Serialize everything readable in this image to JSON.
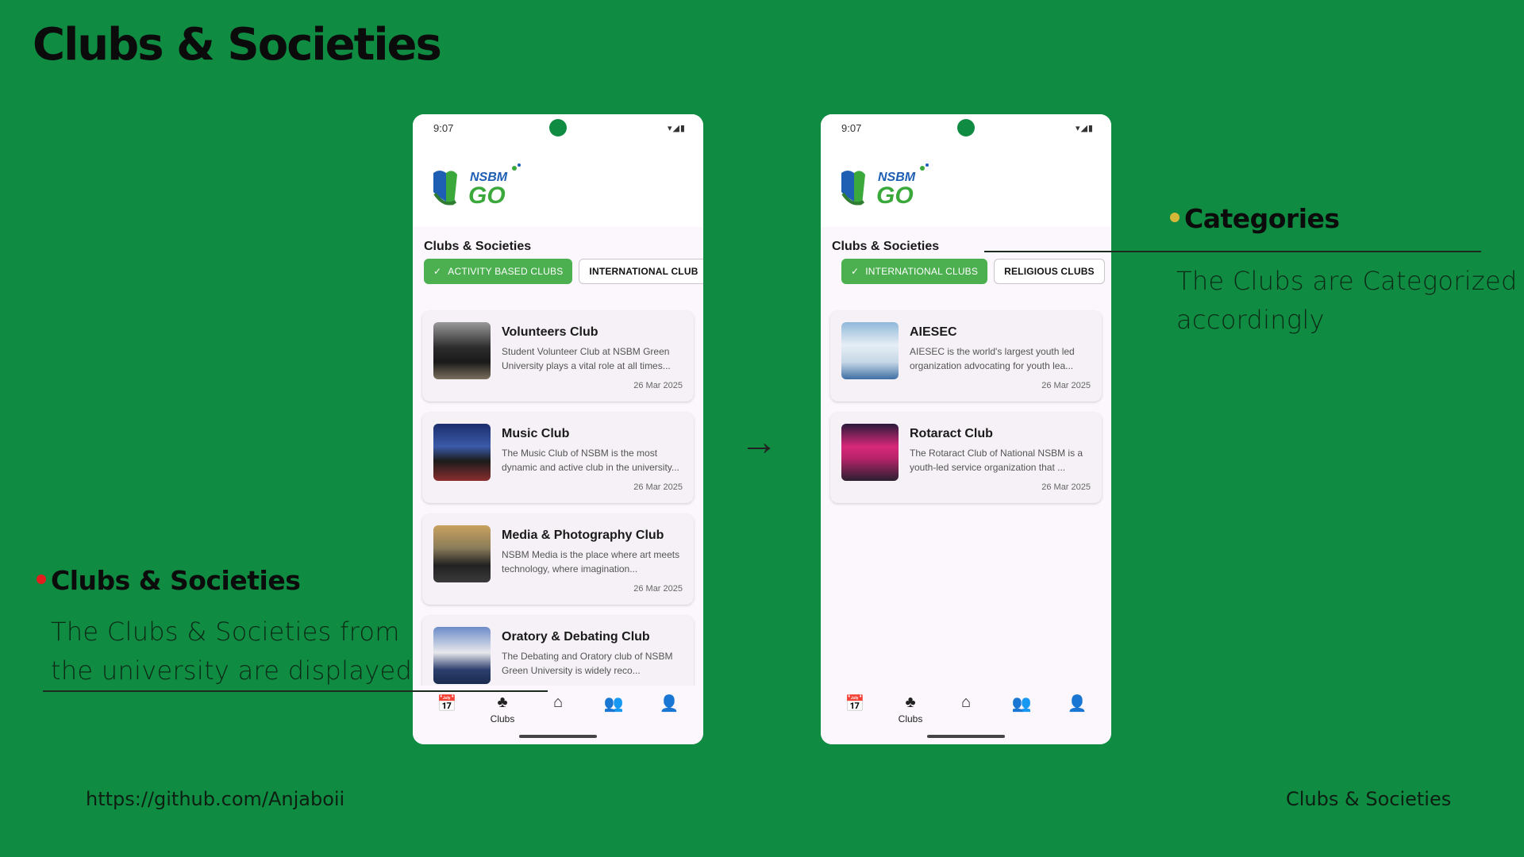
{
  "slide": {
    "title": "Clubs & Societies",
    "footer_left": "https://github.com/Anjaboii",
    "footer_right": "Clubs & Societies"
  },
  "annotations": {
    "categories": {
      "title": "Categories",
      "text_line1": "The Clubs are Categorized",
      "text_line2": "accordingly",
      "dot_color": "#d6b838"
    },
    "clubs": {
      "title": "Clubs & Societies",
      "text_line1": "The Clubs & Societies from",
      "text_line2": "the university are displayed",
      "dot_color": "#e11d1d"
    }
  },
  "arrow": "→",
  "colors": {
    "background": "#0f8c42",
    "chip_active": "#4caf50"
  },
  "phones": [
    {
      "status_time": "9:07",
      "status_icons": "▾◢▮",
      "logo_text": "NSBM GO",
      "section_title": "Clubs & Societies",
      "chips": [
        {
          "label": "ACTIVITY BASED CLUBS",
          "active": true
        },
        {
          "label": "INTERNATIONAL CLUB",
          "active": false
        }
      ],
      "clubs": [
        {
          "title": "Volunteers Club",
          "desc": "Student Volunteer Club at NSBM Green University plays a vital role at all times...",
          "date": "26 Mar 2025"
        },
        {
          "title": "Music Club",
          "desc": "The Music Club of NSBM is the most dynamic and active club in the university...",
          "date": "26 Mar 2025"
        },
        {
          "title": "Media & Photography Club",
          "desc": "NSBM Media is the place where art meets technology, where imagination...",
          "date": "26 Mar 2025"
        },
        {
          "title": "Oratory & Debating Club",
          "desc": "The Debating and Oratory club of NSBM Green University is widely reco...",
          "date": ""
        }
      ],
      "nav": [
        {
          "icon": "calendar-icon",
          "glyph": "📅",
          "label": ""
        },
        {
          "icon": "clubs-icon",
          "glyph": "♣",
          "label": "Clubs"
        },
        {
          "icon": "home-icon",
          "glyph": "⌂",
          "label": ""
        },
        {
          "icon": "groups-icon",
          "glyph": "👥",
          "label": ""
        },
        {
          "icon": "account-icon",
          "glyph": "👤",
          "label": ""
        }
      ]
    },
    {
      "status_time": "9:07",
      "status_icons": "▾◢▮",
      "logo_text": "NSBM GO",
      "section_title": "Clubs & Societies",
      "chips": [
        {
          "label": "INTERNATIONAL CLUBS",
          "active": true
        },
        {
          "label": "RELIGIOUS CLUBS",
          "active": false
        }
      ],
      "clubs": [
        {
          "title": "AIESEC",
          "desc": "AIESEC is the world's largest youth led organization advocating for youth lea...",
          "date": "26 Mar 2025"
        },
        {
          "title": "Rotaract Club",
          "desc": "The Rotaract Club of National NSBM is a youth-led service organization that ...",
          "date": "26 Mar 2025"
        }
      ],
      "nav": [
        {
          "icon": "calendar-icon",
          "glyph": "📅",
          "label": ""
        },
        {
          "icon": "clubs-icon",
          "glyph": "♣",
          "label": "Clubs"
        },
        {
          "icon": "home-icon",
          "glyph": "⌂",
          "label": ""
        },
        {
          "icon": "groups-icon",
          "glyph": "👥",
          "label": ""
        },
        {
          "icon": "account-icon",
          "glyph": "👤",
          "label": ""
        }
      ]
    }
  ]
}
